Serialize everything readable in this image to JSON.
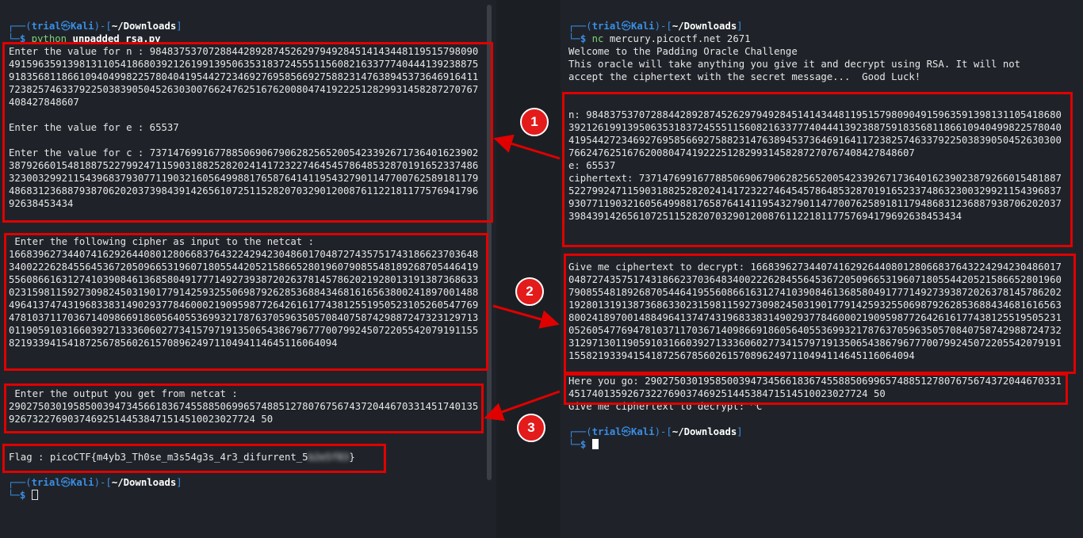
{
  "prompt": {
    "open": "┌──(",
    "user": "trial",
    "at": "㉿",
    "host": "Kali",
    "mid": ")-[",
    "path": "~/Downloads",
    "close": "]",
    "second": "└─",
    "dollar": "$"
  },
  "left": {
    "cmd_name": "python",
    "cmd_arg": "unpadded_rsa.py",
    "n_label": "Enter the value for n : ",
    "n_value": "98483753707288442892874526297949284514143448119515798090491596359139813110541868039212619913950635318372455511560821633777404441392388759183568118661094049982257804041954427234692769585669275882314763894537364691641172382574633792250383905045263030076624762516762008047419222512829931458287270767408427848607",
    "e_line": "Enter the value for e : 65537",
    "c_label": "Enter the value for c : ",
    "c_value": "7371476991677885069067906282565200542339267173640162390238792660154818875227992471159031882528202414172322746454578648532870191652337486323003299211543968379307711903216056499881765876414119543279011477007625891811794868312368879387062020373984391426561072511528207032901200876112218117757694179692638453434",
    "cipher_label": " Enter the following cipher as input to the netcat :",
    "cipher_value": "1668396273440741629264408012806683764322429423048601704872743575174318662370364834002226284556453672050966531960718055442052158665280196079085548189268705446419556086616312741039084613685804917771492739387202637814578620219280131913873686330231598115927309824503190177914259325506987926285368843468161656380024189700148849641374743196833831490293778460002190959877264261617743812551950523105260547769478103711703671409866918605640553699321787637059635057084075874298872473231297130119059103166039271333606027734157971913506543867967770079924507220554207919115582193394154187256785602615708962497110494114645116064094",
    "output_label": " Enter the output you get from netcat :",
    "output_value": "29027503019585003947345661836745588506996574885127807675674372044670331451740135926732276903746925144538471514510023027724 50",
    "flag_prefix": "Flag : picoCTF{m4yb3_Th0se_m3s54g3s_4r3_difurrent_5",
    "flag_redacted": "b2e5f83",
    "flag_suffix": "}"
  },
  "right": {
    "cmd_name": "nc",
    "cmd_arg": "mercury.picoctf.net 2671",
    "welcome": "Welcome to the Padding Oracle Challenge",
    "oracle_line1": "This oracle will take anything you give it and decrypt using RSA. It will not",
    "oracle_line2": "accept the ciphertext with the secret message...  Good Luck!",
    "n_line": "n: 98483753707288442892874526297949284514143448119515798090491596359139813110541868039212619913950635318372455511560821633777404441392388759183568118661094049982257804041954427234692769585669275882314763894537364691641172382574633792250383905045263030076624762516762008047419222512829931458287270767408427848607",
    "e_line": "e: 65537",
    "ct_line": "ciphertext: 7371476991677885069067906282565200542339267173640162390238792660154818875227992471159031882528202414172322746454578648532870191652337486323003299211543968379307711903216056499881765876414119543279011477007625891811794868312368879387062020373984391426561072511528207032901200876112218117757694179692638453434",
    "give_line": "Give me ciphertext to decrypt: 1668396273440741629264408012806683764322429423048601704872743575174318662370364834002226284556453672050966531960718055442052158665280196079085548189268705446419556086616312741039084613685804917771492739387202637814578620219280131913873686330231598115927309824503190177914259325506987926285368843468161656380024189700148849641374743196833831490293778460002190959877264261617743812551950523105260547769478103711703671409866918605640553699321787637059635057084075874298872473231297130119059103166039271333606027734157971913506543867967770079924507220554207919115582193394154187256785602615708962497110494114645116064094",
    "here_line": "Here you go: 29027503019585003947345661836745588506996574885127807675674372044670331451740135926732276903746925144538471514510023027724 50",
    "give_again": "Give me ciphertext to decrypt: ^C"
  },
  "annotations": [
    "1",
    "2",
    "3"
  ],
  "colors": {
    "terminal_bg": "#1f2329",
    "highlight_red": "#e00000",
    "prompt_blue": "#3a8ee6",
    "prompt_green": "#7fd27a"
  }
}
